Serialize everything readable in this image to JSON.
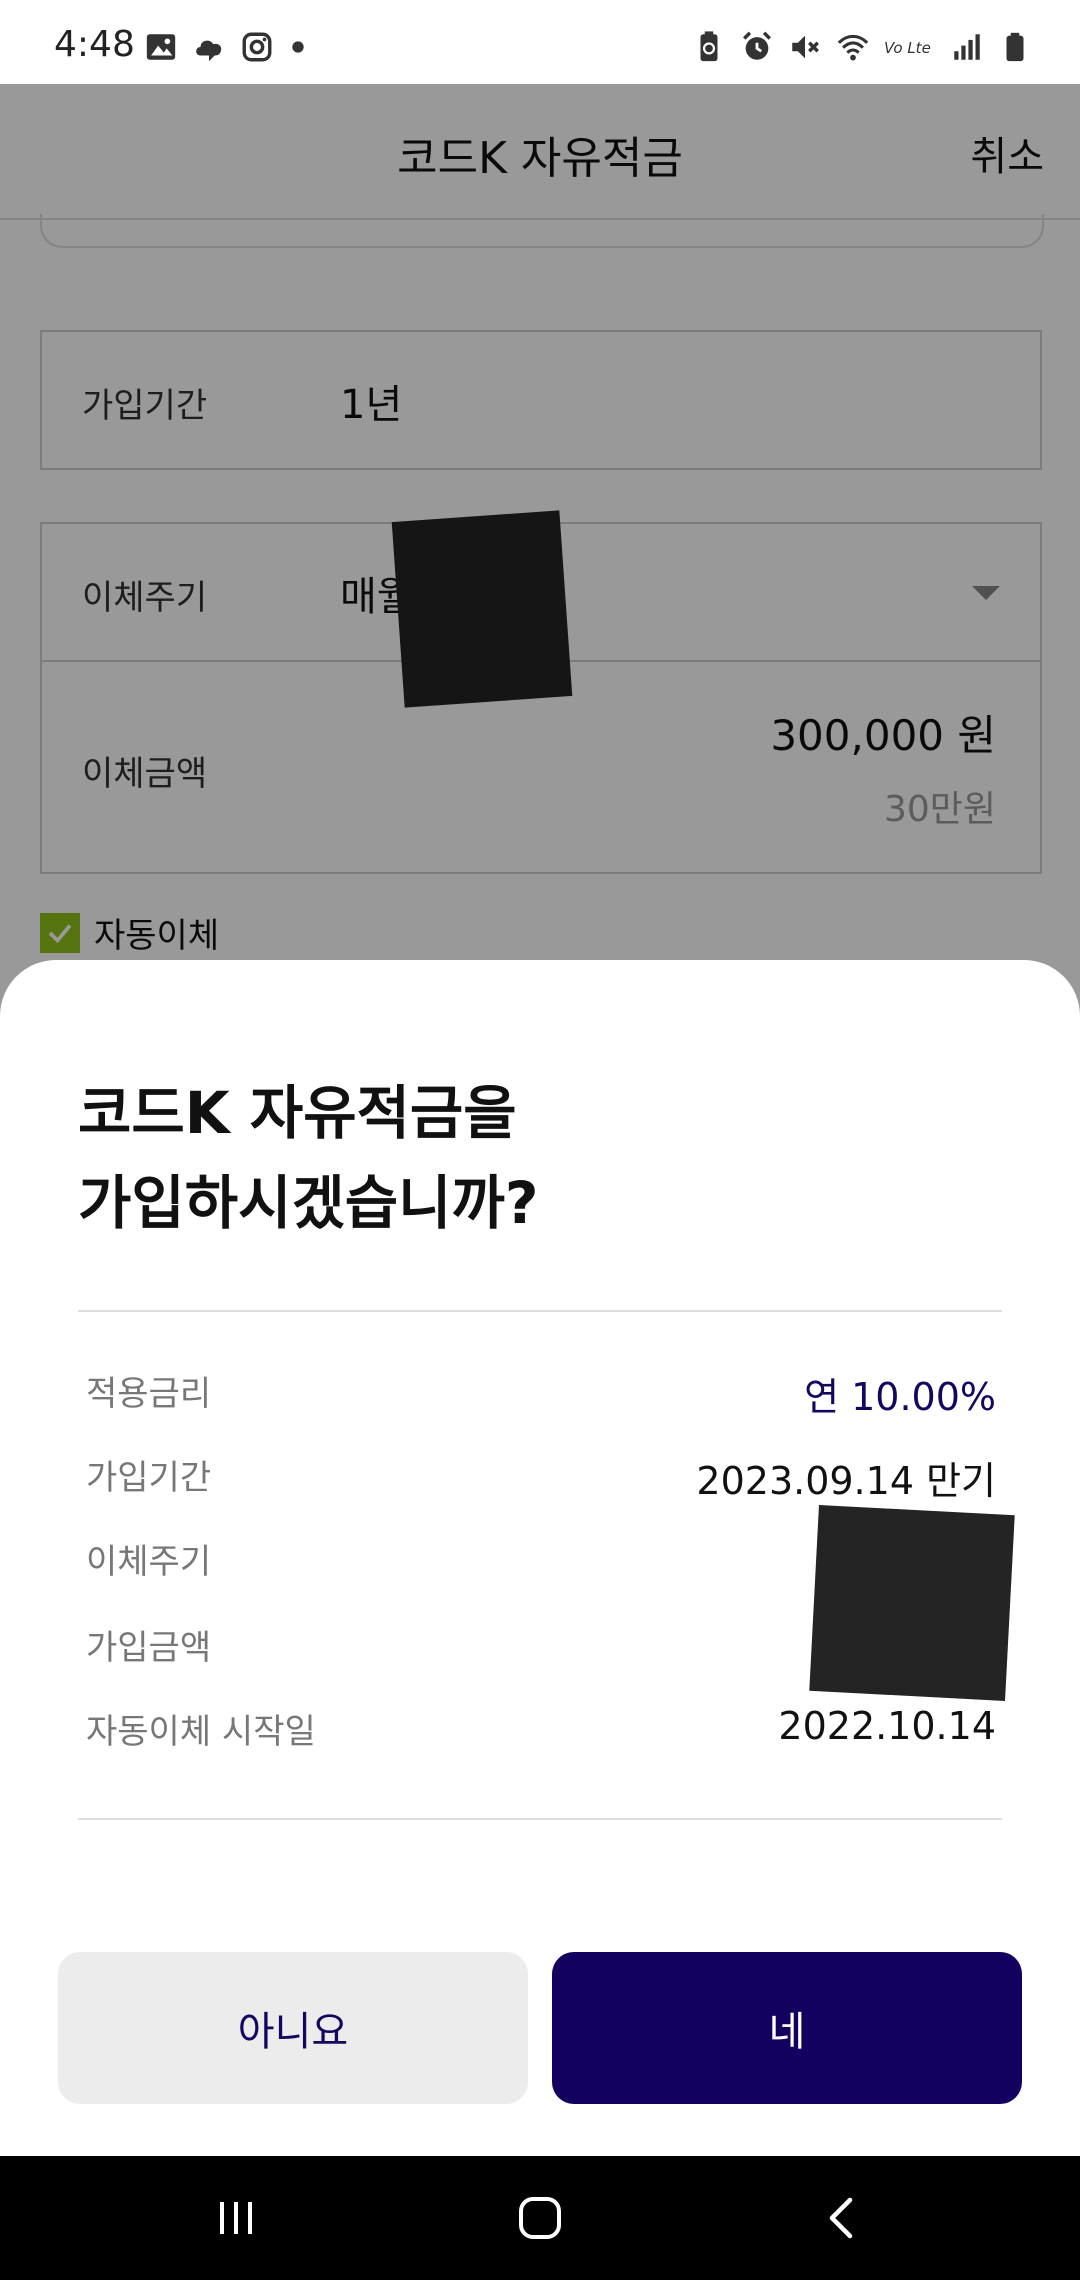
{
  "status_bar": {
    "time": "4:48",
    "left_icons": [
      "gallery-icon",
      "cloud-icon",
      "instagram-icon",
      "dot-icon"
    ],
    "right_icons": [
      "battery-saver-icon",
      "alarm-icon",
      "mute-icon",
      "wifi-icon",
      "volte-icon",
      "signal-icon",
      "battery-icon"
    ],
    "volte_label": "Vo Lte"
  },
  "header": {
    "title": "코드K 자유적금",
    "cancel": "취소"
  },
  "form": {
    "period_label": "가입기간",
    "period_value": "1년",
    "cycle_label": "이체주기",
    "cycle_value": "매월",
    "amount_label": "이체금액",
    "amount_value": "300,000 원",
    "amount_sub": "30만원",
    "auto_transfer_label": "자동이체",
    "auto_transfer_checked": true
  },
  "sheet": {
    "question_line1": "코드K 자유적금을",
    "question_line2": "가입하시겠습니까?",
    "rows": [
      {
        "label": "적용금리",
        "value": "연 10.00%"
      },
      {
        "label": "가입기간",
        "value": "2023.09.14 만기"
      },
      {
        "label": "이체주기",
        "value": ""
      },
      {
        "label": "가입금액",
        "value": ""
      },
      {
        "label": "자동이체 시작일",
        "value": "2022.10.14"
      }
    ],
    "no_button": "아니요",
    "yes_button": "네"
  },
  "colors": {
    "primary": "#14005e",
    "check_green": "#8ec21b",
    "secondary_button_bg": "#ececec"
  },
  "nav_icons": [
    "recent-apps-icon",
    "home-icon",
    "back-icon"
  ]
}
